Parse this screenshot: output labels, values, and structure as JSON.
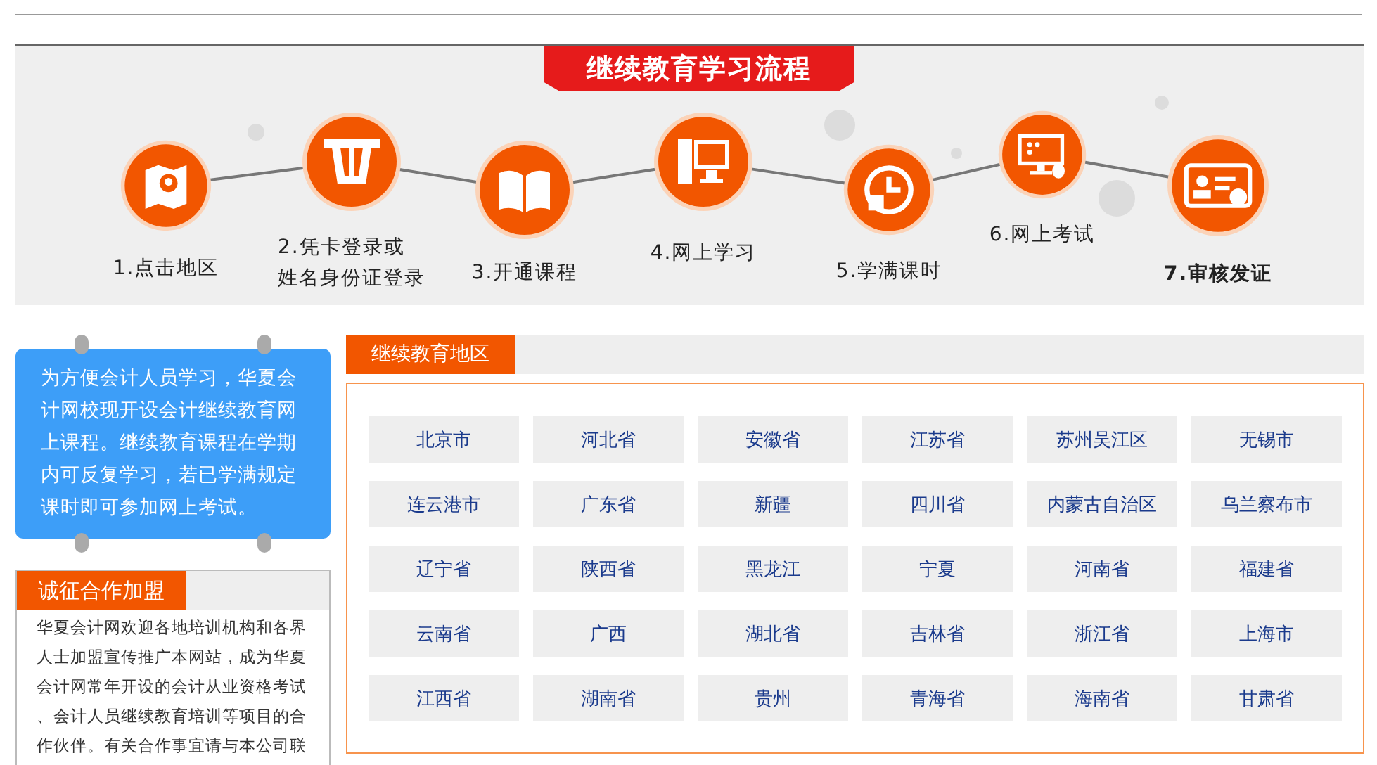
{
  "process": {
    "title": "继续教育学习流程",
    "steps": [
      {
        "kind": "map",
        "label": [
          "1.点击地区"
        ],
        "bold": false
      },
      {
        "kind": "card",
        "label": [
          "2.凭卡登录或",
          "姓名身份证登录"
        ],
        "bold": false
      },
      {
        "kind": "book",
        "label": [
          "3.开通课程"
        ],
        "bold": false
      },
      {
        "kind": "computer",
        "label": [
          "4.网上学习"
        ],
        "bold": false
      },
      {
        "kind": "clock",
        "label": [
          "5.学满课时"
        ],
        "bold": false
      },
      {
        "kind": "monitor",
        "label": [
          "6.网上考试"
        ],
        "bold": false
      },
      {
        "kind": "certificate",
        "label": [
          "7.审核发证"
        ],
        "bold": true
      }
    ]
  },
  "notice": {
    "text": "为方便会计人员学习，华夏会计网校现开设会计继续教育网上课程。继续教育课程在学期内可反复学习，若已学满规定课时即可参加网上考试。"
  },
  "partner": {
    "title": "诚征合作加盟",
    "text": "华夏会计网欢迎各地培训机构和各界人士加盟宣传推广本网站，成为华夏会计网常年开设的会计从业资格考试、会计人员继续教育培训等项目的合作伙伴。有关合作事宜请与本公司联"
  },
  "regions": {
    "title": "继续教育地区",
    "items": [
      "北京市",
      "河北省",
      "安徽省",
      "江苏省",
      "苏州吴江区",
      "无锡市",
      "连云港市",
      "广东省",
      "新疆",
      "四川省",
      "内蒙古自治区",
      "乌兰察布市",
      "辽宁省",
      "陕西省",
      "黑龙江",
      "宁夏",
      "河南省",
      "福建省",
      "云南省",
      "广西",
      "湖北省",
      "吉林省",
      "浙江省",
      "上海市",
      "江西省",
      "湖南省",
      "贵州",
      "青海省",
      "海南省",
      "甘肃省"
    ]
  }
}
